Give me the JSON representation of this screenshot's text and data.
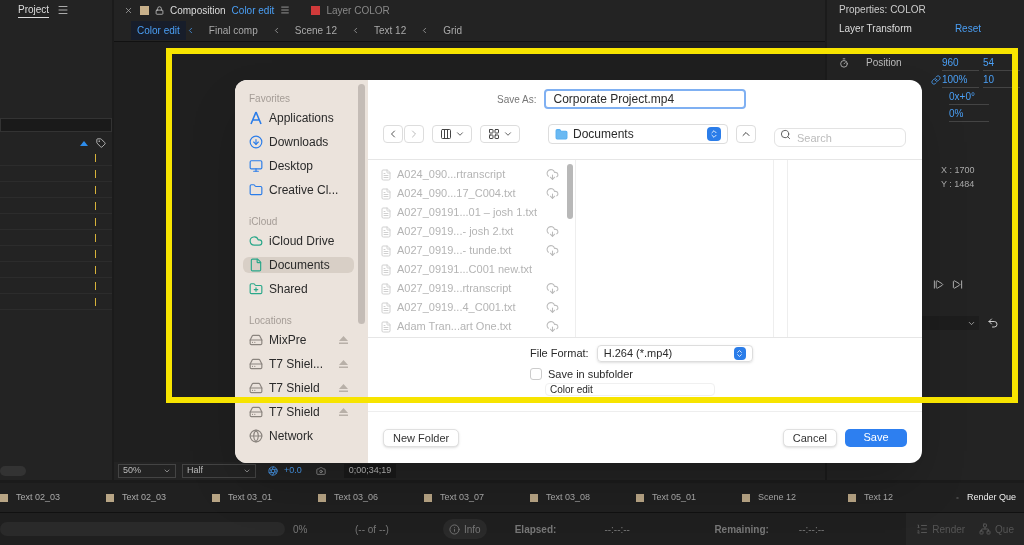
{
  "project_panel": {
    "tab": "Project",
    "rows": [
      {
        "marked": true
      },
      {
        "marked": true
      },
      {
        "marked": true
      },
      {
        "marked": true
      },
      {
        "marked": true
      },
      {
        "marked": true
      },
      {
        "marked": true
      },
      {
        "marked": true
      },
      {
        "marked": true
      },
      {
        "marked": true
      }
    ]
  },
  "composition_panel": {
    "tabs": [
      {
        "label": "Composition",
        "sub": "Color edit",
        "selected": true,
        "color": "#c8b08a"
      },
      {
        "label": "Layer COLOR",
        "selected": false,
        "color": "#d03a3a"
      }
    ],
    "breadcrumbs": [
      {
        "label": "Color edit",
        "selected": true
      },
      {
        "label": "Final comp",
        "selected": false
      },
      {
        "label": "Scene 12",
        "selected": false
      },
      {
        "label": "Text 12",
        "selected": false
      },
      {
        "label": "Grid",
        "selected": false
      }
    ],
    "viewer_bar": {
      "zoom": "50%",
      "resolution": "Half",
      "exposure": "+0.0",
      "timecode": "0;00;34;19"
    }
  },
  "properties_panel": {
    "title": "Properties: COLOR",
    "section": "Layer Transform",
    "reset": "Reset",
    "rows": [
      {
        "name": "Position",
        "linked": false,
        "values": [
          "960",
          "54"
        ]
      },
      {
        "linked": true,
        "values": [
          "100%",
          "10"
        ]
      },
      {
        "linked": false,
        "values": [
          "0x+0°"
        ]
      },
      {
        "linked": false,
        "values": [
          "0%"
        ]
      }
    ],
    "coords": [
      "X : 1700",
      "Y : 1484"
    ]
  },
  "dialog": {
    "save_as": {
      "label": "Save As:",
      "value": "Corporate Project.mp4"
    },
    "location": "Documents",
    "search": {
      "placeholder": "Search"
    },
    "sidebar": [
      {
        "heading": "Favorites",
        "items": [
          {
            "label": "Applications",
            "kind": "applications",
            "selected": false,
            "ejectable": false
          },
          {
            "label": "Downloads",
            "kind": "downloads",
            "selected": false,
            "ejectable": false
          },
          {
            "label": "Desktop",
            "kind": "desktop",
            "selected": false,
            "ejectable": false
          },
          {
            "label": "Creative Cl...",
            "kind": "folder",
            "selected": false,
            "ejectable": false
          }
        ]
      },
      {
        "heading": "iCloud",
        "items": [
          {
            "label": "iCloud Drive",
            "kind": "cloud",
            "selected": false,
            "ejectable": false
          },
          {
            "label": "Documents",
            "kind": "document",
            "selected": true,
            "ejectable": false
          },
          {
            "label": "Shared",
            "kind": "shared",
            "selected": false,
            "ejectable": false
          }
        ]
      },
      {
        "heading": "Locations",
        "items": [
          {
            "label": "MixPre",
            "kind": "drive",
            "selected": false,
            "ejectable": true
          },
          {
            "label": "T7 Shiel...",
            "kind": "drive",
            "selected": false,
            "ejectable": true
          },
          {
            "label": "T7 Shield",
            "kind": "drive",
            "selected": false,
            "ejectable": true
          },
          {
            "label": "T7 Shield",
            "kind": "drive",
            "selected": false,
            "ejectable": true
          },
          {
            "label": "Network",
            "kind": "network",
            "selected": false,
            "ejectable": false
          }
        ]
      }
    ],
    "files": [
      {
        "name": "A024_090...rtranscript",
        "cloud": true
      },
      {
        "name": "A024_090...17_C004.txt",
        "cloud": true
      },
      {
        "name": "A027_09191...01 – josh 1.txt",
        "cloud": false
      },
      {
        "name": "A027_0919...- josh 2.txt",
        "cloud": true
      },
      {
        "name": "A027_0919...- tunde.txt",
        "cloud": true
      },
      {
        "name": "A027_09191...C001 new.txt",
        "cloud": false
      },
      {
        "name": "A027_0919...rtranscript",
        "cloud": true
      },
      {
        "name": "A027_0919...4_C001.txt",
        "cloud": true
      },
      {
        "name": "Adam Tran...art One.txt",
        "cloud": true
      }
    ],
    "file_format": {
      "label": "File Format:",
      "value": "H.264 (*.mp4)"
    },
    "subfolder": {
      "label": "Save in subfolder",
      "checked": false,
      "value": "Color edit"
    },
    "buttons": [
      {
        "label": "New Folder",
        "kind": "secondary"
      },
      {
        "label": "Cancel",
        "kind": "secondary"
      },
      {
        "label": "Save",
        "kind": "primary"
      }
    ]
  },
  "timeline_tabs": [
    {
      "label": "Text 02_03",
      "selected": false
    },
    {
      "label": "Text 02_03",
      "selected": false
    },
    {
      "label": "Text 03_01",
      "selected": false
    },
    {
      "label": "Text 03_06",
      "selected": false
    },
    {
      "label": "Text 03_07",
      "selected": false
    },
    {
      "label": "Text 03_08",
      "selected": false
    },
    {
      "label": "Text 05_01",
      "selected": false
    },
    {
      "label": "Scene 12",
      "selected": false
    },
    {
      "label": "Text 12",
      "selected": false
    },
    {
      "label": "Render Que",
      "selected": true
    }
  ],
  "render_bar": {
    "level": 0,
    "progress": "0%",
    "count": "(-- of --)",
    "info": "Info",
    "elapsed_label": "Elapsed:",
    "elapsed": "--:--:--",
    "remaining_label": "Remaining:",
    "remaining": "--:--:--",
    "render": "Render",
    "queue": "Que"
  }
}
